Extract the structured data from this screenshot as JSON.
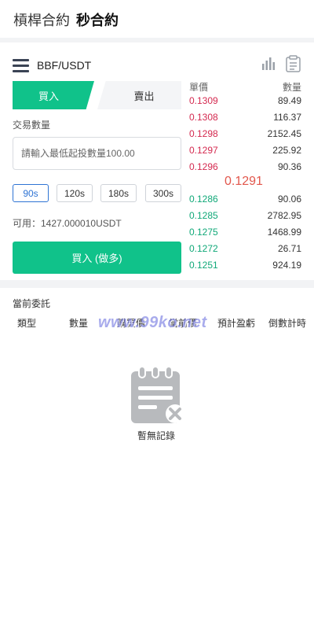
{
  "top_tabs": [
    "槓桿合約",
    "秒合約"
  ],
  "header": {
    "pair": "BBF/USDT",
    "icons": [
      "menu-icon",
      "bar-chart-icon",
      "clipboard-icon"
    ]
  },
  "trade_tabs": {
    "buy": "買入",
    "sell": "賣出"
  },
  "form": {
    "qty_label": "交易數量",
    "qty_placeholder": "請輸入最低起投數量100.00",
    "qty_value": "",
    "periods": [
      "90s",
      "120s",
      "180s",
      "300s"
    ],
    "active_period": "90s",
    "available": "可用：1427.000010USDT",
    "submit_label": "買入 (做多)"
  },
  "order_book": {
    "price_header": "單價",
    "qty_header": "數量",
    "asks": [
      {
        "price": "0.1309",
        "qty": "89.49"
      },
      {
        "price": "0.1308",
        "qty": "116.37"
      },
      {
        "price": "0.1298",
        "qty": "2152.45"
      },
      {
        "price": "0.1297",
        "qty": "225.92"
      },
      {
        "price": "0.1296",
        "qty": "90.36"
      }
    ],
    "last_price": "0.1291",
    "bids": [
      {
        "price": "0.1286",
        "qty": "90.06"
      },
      {
        "price": "0.1285",
        "qty": "2782.95"
      },
      {
        "price": "0.1275",
        "qty": "1468.99"
      },
      {
        "price": "0.1272",
        "qty": "26.71"
      },
      {
        "price": "0.1251",
        "qty": "924.19"
      }
    ]
  },
  "orders": {
    "title": "當前委託",
    "columns": [
      "類型",
      "數量",
      "購買價",
      "當前價",
      "預計盈虧",
      "倒數計時"
    ],
    "empty_text": "暫無記錄"
  },
  "watermark": "www.99ko.net",
  "colors": {
    "buy_green": "#10c28a",
    "ask_red": "#d4294f",
    "bid_green": "#10a878",
    "last_price": "#e2574c",
    "active_blue": "#2f74d4"
  }
}
